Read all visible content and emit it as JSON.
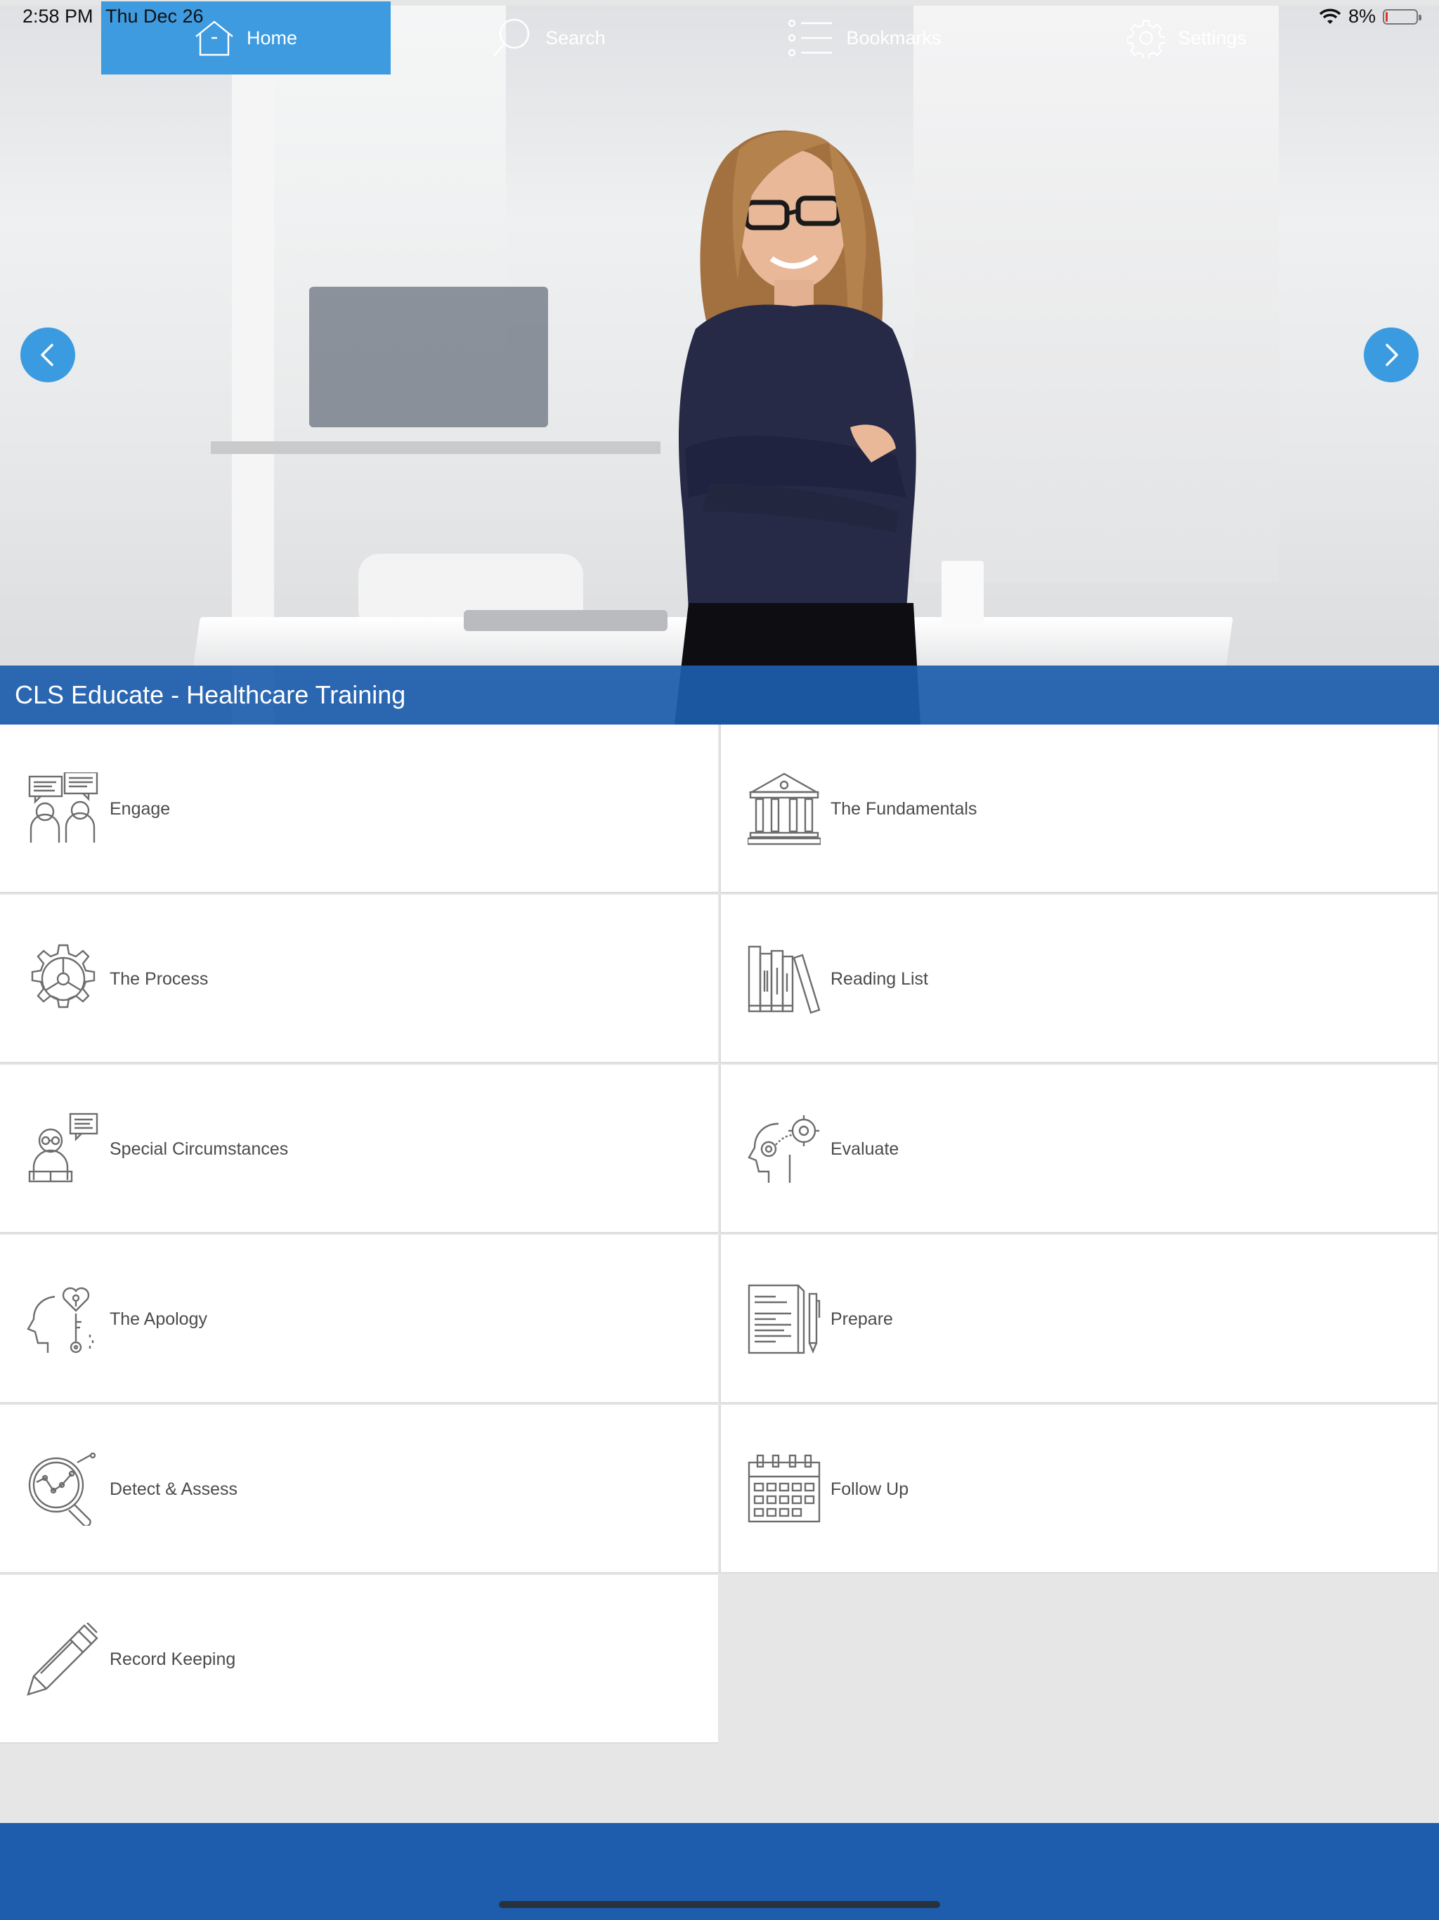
{
  "status_bar": {
    "time": "2:58 PM",
    "date": "Thu Dec 26",
    "battery_percent": "8%",
    "battery_level": 0.08,
    "wifi_icon": "wifi-icon"
  },
  "hero": {
    "caption": "CLS Educate - Healthcare Training",
    "prev_icon": "chevron-left-icon",
    "next_icon": "chevron-right-icon"
  },
  "menu": {
    "items": [
      {
        "label": "Engage",
        "icon": "conversation-icon"
      },
      {
        "label": "The Fundamentals",
        "icon": "courthouse-icon"
      },
      {
        "label": "The Process",
        "icon": "gear-icon"
      },
      {
        "label": "Reading List",
        "icon": "books-icon"
      },
      {
        "label": "Special Circumstances",
        "icon": "person-reading-icon"
      },
      {
        "label": "Evaluate",
        "icon": "head-gears-icon"
      },
      {
        "label": "The Apology",
        "icon": "head-heart-key-icon"
      },
      {
        "label": "Prepare",
        "icon": "document-pen-icon"
      },
      {
        "label": "Detect & Assess",
        "icon": "magnifier-chart-icon"
      },
      {
        "label": "Follow Up",
        "icon": "calendar-icon"
      },
      {
        "label": "Record Keeping",
        "icon": "pen-icon"
      }
    ]
  },
  "tabbar": {
    "tabs": [
      {
        "label": "Home",
        "icon": "home-icon",
        "active": true
      },
      {
        "label": "Search",
        "icon": "search-icon",
        "active": false
      },
      {
        "label": "Bookmarks",
        "icon": "list-icon",
        "active": false
      },
      {
        "label": "Settings",
        "icon": "gear-icon",
        "active": false
      }
    ]
  },
  "colors": {
    "brand_blue": "#1e5dad",
    "accent_blue": "#3e9be0",
    "background": "#e6e6e7"
  }
}
